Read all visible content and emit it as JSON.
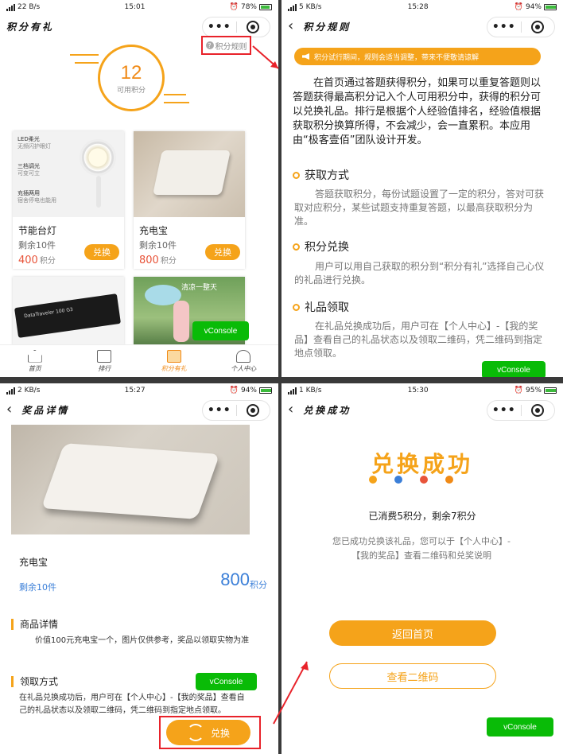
{
  "colors": {
    "accent": "#f5a31a",
    "price": "#e8543a",
    "blue": "#3b7fd8",
    "annotation": "#e8222a",
    "vconsole": "#09bb07"
  },
  "panel1": {
    "status": {
      "signal": "ıl 紹ıl",
      "speed": "22 B/s",
      "time": "15:01",
      "icons": "⏰ ⏰",
      "battery": "78%"
    },
    "title": "积分有礼",
    "rules_link": "积分规则",
    "points": {
      "value": "12",
      "label": "可用积分"
    },
    "cards": [
      {
        "name": "节能台灯",
        "stock": "剩余10件",
        "price": "400",
        "unit": "积分",
        "button": "兑换",
        "img_lines": [
          "LED柔光",
          "无频闪护眼灯",
          "三档调光",
          "可变可立",
          "充插两用",
          "宿舍停电也能用"
        ]
      },
      {
        "name": "充电宝",
        "stock": "剩余10件",
        "price": "800",
        "unit": "积分",
        "button": "兑换"
      },
      {
        "name": "",
        "img_text": "DataTraveler 100 G3"
      },
      {
        "name": "",
        "img_text": "清凉一整天"
      }
    ],
    "vconsole": "vConsole",
    "tabs": [
      {
        "label": "首页",
        "icon": "home-icon"
      },
      {
        "label": "排行",
        "icon": "rank-icon"
      },
      {
        "label": "积分有礼",
        "icon": "gift-icon"
      },
      {
        "label": "个人中心",
        "icon": "user-icon"
      }
    ]
  },
  "panel2": {
    "status": {
      "signal": "ıl 紹ıl",
      "speed": "5 KB/s",
      "time": "15:28",
      "icons": "⏰ ⏰",
      "battery": "94%"
    },
    "title": "积分规则",
    "notice": "积分试行期间，规则会适当调整，带来不便敬请谅解",
    "intro": "在首页通过答题获得积分，如果可以重复答题则以答题获得最高积分记入个人可用积分中，获得的积分可以兑换礼品。排行是根据个人经验值排名，经验值根据获取积分换算所得，不会减少，会一直累积。本应用由“极客壹佰”团队设计开发。",
    "sections": [
      {
        "heading": "获取方式",
        "text": "答题获取积分，每份试题设置了一定的积分，答对可获取对应积分，某些试题支持重复答题，以最高获取积分为准。"
      },
      {
        "heading": "积分兑换",
        "text": "用户可以用自己获取的积分到“积分有礼”选择自己心仪的礼品进行兑换。"
      },
      {
        "heading": "礼品领取",
        "text": "在礼品兑换成功后，用户可在【个人中心】-【我的奖品】查看自己的礼品状态以及领取二维码，凭二维码到指定地点领取。"
      }
    ],
    "vconsole": "vConsole"
  },
  "panel3": {
    "status": {
      "signal": "ıl 紹ıl",
      "speed": "2 KB/s",
      "time": "15:27",
      "icons": "⏰ ⏰",
      "battery": "94%"
    },
    "title": "奖品详情",
    "product": {
      "name": "充电宝",
      "stock": "剩余10件",
      "price": "800",
      "unit": "积分"
    },
    "details_heading": "商品详情",
    "details_text": "价值100元充电宝一个，图片仅供参考，奖品以领取实物为准",
    "method_heading": "领取方式",
    "method_text": "在礼品兑换成功后，用户可在【个人中心】-【我的奖品】查看自己的礼品状态以及领取二维码，凭二维码到指定地点领取。",
    "exchange_button": "兑换",
    "vconsole": "vConsole"
  },
  "panel4": {
    "status": {
      "signal": "ıl 紹ıl",
      "speed": "1 KB/s",
      "time": "15:30",
      "icons": "⏰ ⏰",
      "battery": "95%"
    },
    "title": "兑换成功",
    "headline": "兑换成功",
    "dot_colors": [
      "#f5a31a",
      "#3b7fd8",
      "#e8543a",
      "#f08a16"
    ],
    "consumed": "已消费5积分，剩余7积分",
    "message": "您已成功兑换该礼品，您可以于【个人中心】-【我的奖品】查看二维码和兑奖说明",
    "home_button": "返回首页",
    "qr_button": "查看二维码",
    "vconsole": "vConsole"
  }
}
